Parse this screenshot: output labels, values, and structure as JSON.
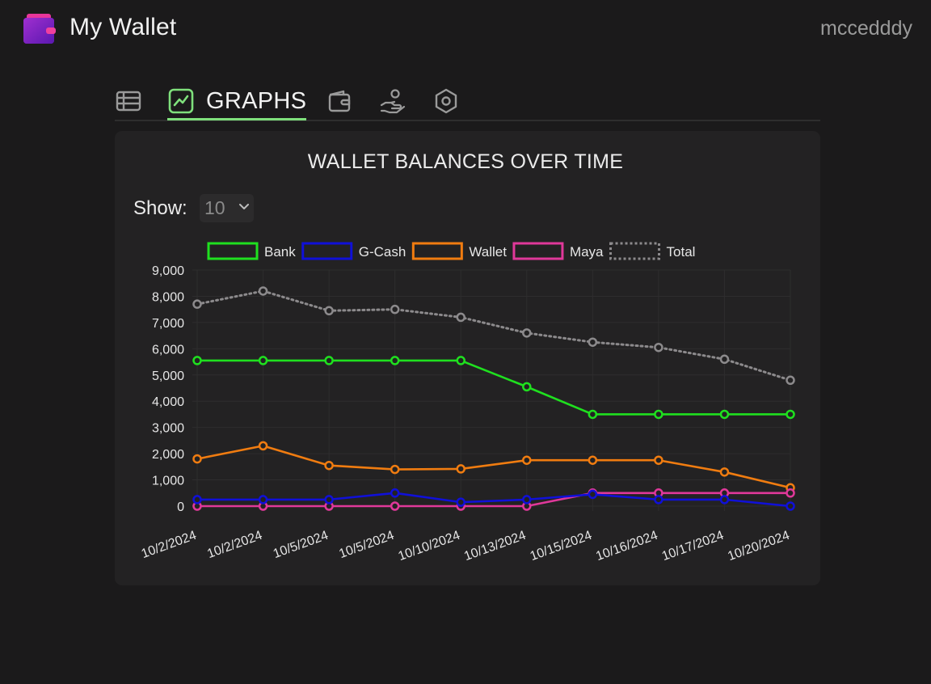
{
  "app": {
    "title": "My Wallet",
    "username": "mccedddy",
    "brand_color": "#9b2fc8"
  },
  "tabs": [
    {
      "icon": "table-icon",
      "label": ""
    },
    {
      "icon": "line-chart-icon",
      "label": "GRAPHS",
      "active": true
    },
    {
      "icon": "wallet-icon",
      "label": ""
    },
    {
      "icon": "hand-coin-icon",
      "label": ""
    },
    {
      "icon": "settings-hex-icon",
      "label": ""
    }
  ],
  "accent_color": "#7fe07c",
  "card": {
    "title": "WALLET BALANCES OVER TIME",
    "show_label": "Show:",
    "show_value": "10"
  },
  "chart_data": {
    "type": "line",
    "title": "WALLET BALANCES OVER TIME",
    "categories": [
      "10/2/2024",
      "10/2/2024",
      "10/5/2024",
      "10/5/2024",
      "10/10/2024",
      "10/13/2024",
      "10/15/2024",
      "10/16/2024",
      "10/17/2024",
      "10/20/2024"
    ],
    "ylim": [
      0,
      9000
    ],
    "yticks": [
      "9,000",
      "8,000",
      "7,000",
      "6,000",
      "5,000",
      "4,000",
      "3,000",
      "2,000",
      "1,000",
      "0"
    ],
    "legend_position": "top",
    "grid": true,
    "series": [
      {
        "name": "Bank",
        "color": "#1fe01f",
        "dashed": false,
        "values": [
          5550,
          5550,
          5550,
          5550,
          5550,
          4550,
          3500,
          3500,
          3500,
          3500
        ]
      },
      {
        "name": "G-Cash",
        "color": "#1010d8",
        "dashed": false,
        "values": [
          250,
          250,
          250,
          500,
          150,
          250,
          450,
          250,
          250,
          0
        ]
      },
      {
        "name": "Wallet",
        "color": "#f07c10",
        "dashed": false,
        "values": [
          1800,
          2300,
          1550,
          1400,
          1420,
          1750,
          1750,
          1750,
          1300,
          700
        ]
      },
      {
        "name": "Maya",
        "color": "#e0389a",
        "dashed": false,
        "values": [
          0,
          0,
          0,
          0,
          0,
          0,
          500,
          500,
          500,
          500
        ]
      },
      {
        "name": "Total",
        "color": "#8c8a8c",
        "dashed": true,
        "values": [
          7700,
          8200,
          7450,
          7500,
          7200,
          6600,
          6250,
          6050,
          5600,
          4800
        ]
      }
    ]
  }
}
